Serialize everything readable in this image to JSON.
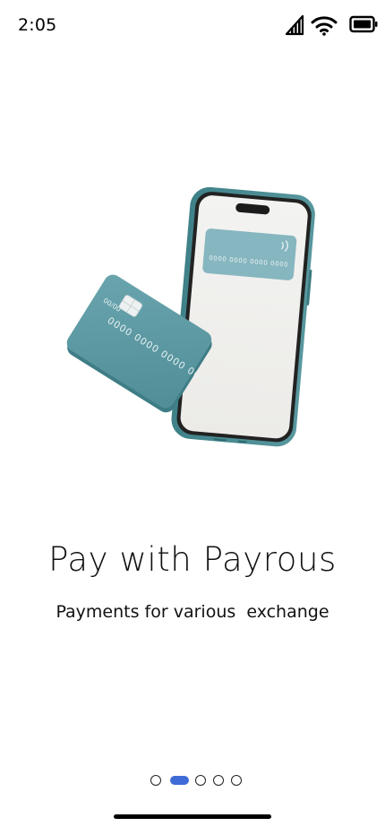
{
  "status_bar": {
    "time": "2:05",
    "icons": [
      "cellular-signal-icon",
      "wifi-icon",
      "battery-icon"
    ]
  },
  "illustration": {
    "description_icon": "phone-and-card-illustration",
    "card_number_mask": "0000 0000 0000 0000",
    "card_expiry_mask": "00/00",
    "phone_card_number_mask": "0000 0000 0000 0000",
    "card_color": "#5f9aa5"
  },
  "onboarding": {
    "title": "Pay with Payrous",
    "subtitle": "Payments for various  exchange"
  },
  "pager": {
    "page_count": 5,
    "active_index": 1,
    "active_color": "#3f6bd6"
  }
}
